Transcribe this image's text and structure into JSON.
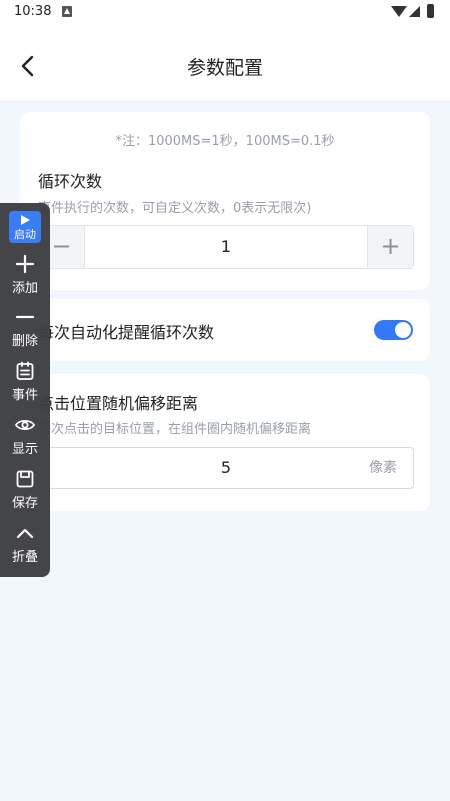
{
  "status": {
    "time": "10:38"
  },
  "header": {
    "title": "参数配置"
  },
  "note": "*注：1000MS=1秒，100MS=0.1秒",
  "loop": {
    "label": "循环次数",
    "desc": "事件执行的次数，可自定义次数，0表示无限次)",
    "value": "1",
    "minus": "−",
    "plus": "+"
  },
  "remind": {
    "label": "每次自动化提醒循环次数",
    "enabled": true
  },
  "offset": {
    "label": "点击位置随机偏移距离",
    "desc": "每次点击的目标位置，在组件圈内随机偏移距离",
    "value": "5",
    "unit": "像素"
  },
  "floatbar": {
    "start": "启动",
    "add": "添加",
    "delete": "删除",
    "events": "事件",
    "show": "显示",
    "save": "保存",
    "collapse": "折叠"
  },
  "colors": {
    "accent": "#3478f6",
    "background": "#f2f6fd",
    "floatbar": "#3d3e42"
  }
}
